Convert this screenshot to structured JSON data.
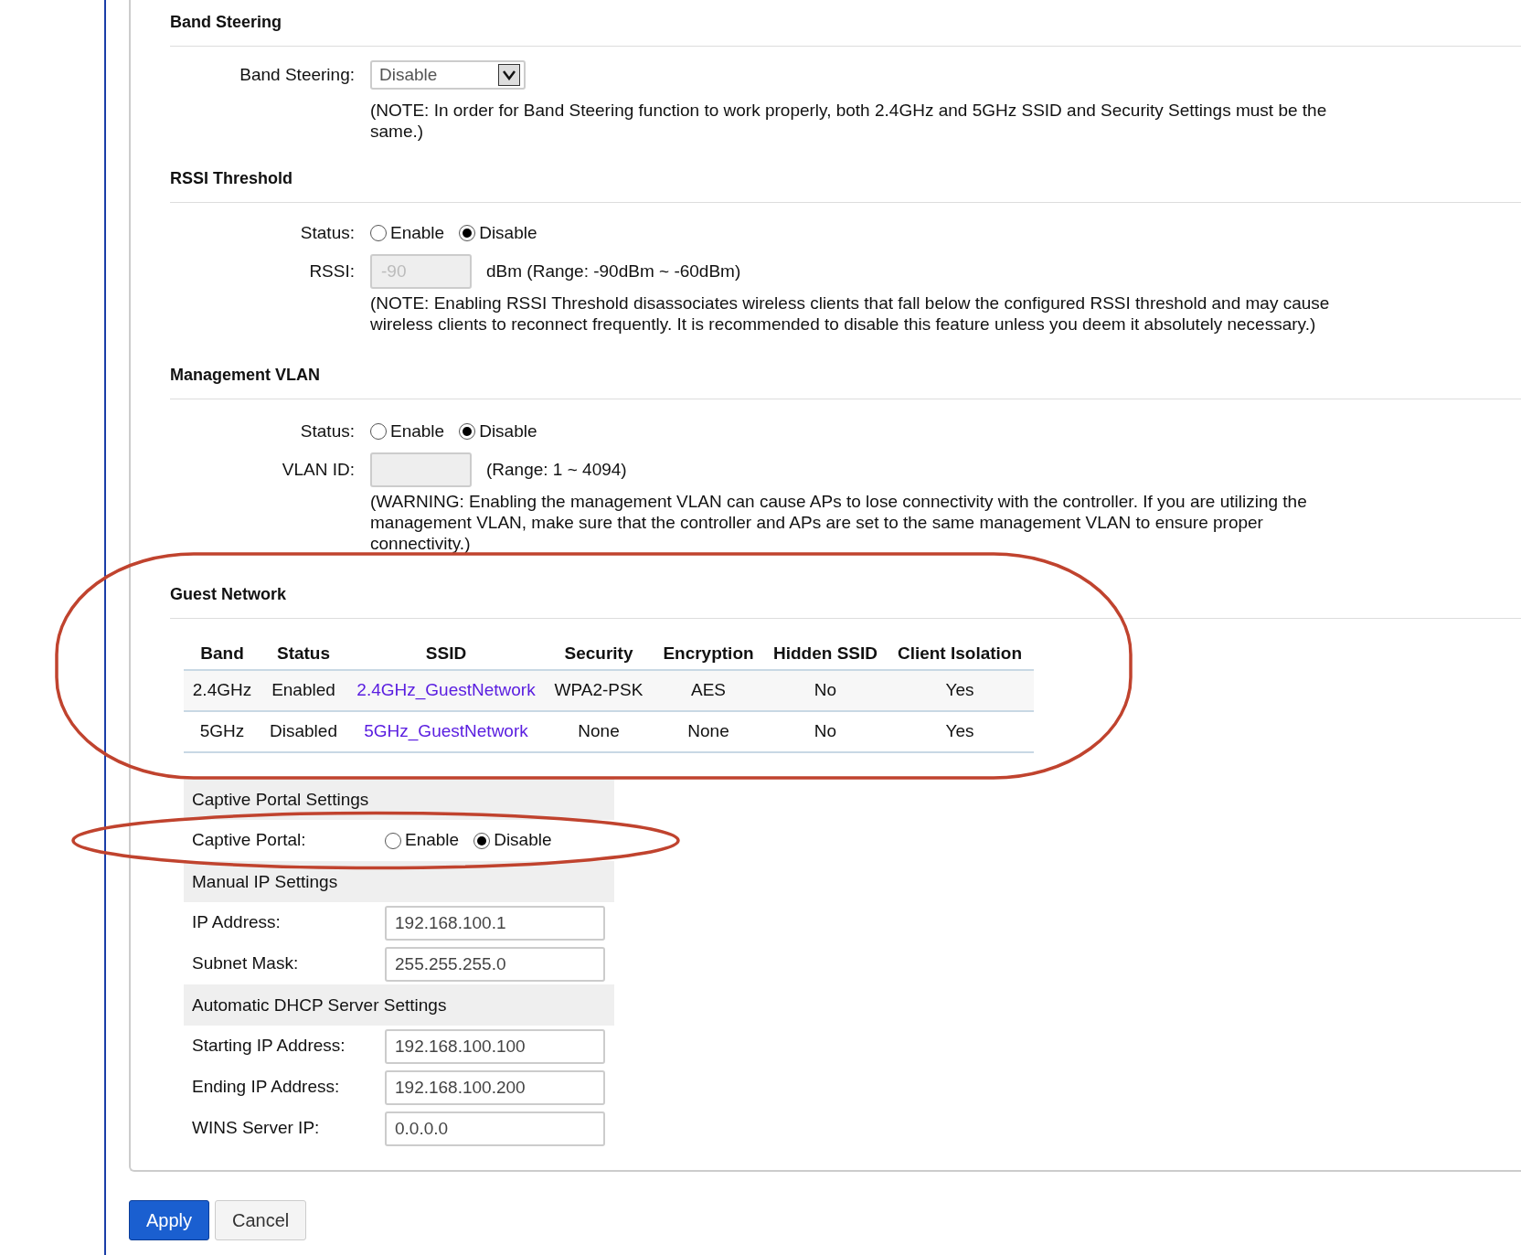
{
  "band_steering": {
    "heading": "Band Steering",
    "label": "Band Steering:",
    "value": "Disable",
    "note": "(NOTE: In order for Band Steering function to work properly, both 2.4GHz and 5GHz SSID and Security Settings must be the same.)"
  },
  "rssi_threshold": {
    "heading": "RSSI Threshold",
    "status_label": "Status:",
    "options": [
      {
        "label": "Enable",
        "selected": false
      },
      {
        "label": "Disable",
        "selected": true
      }
    ],
    "rssi_label": "RSSI:",
    "rssi_value": "-90",
    "rssi_disabled": true,
    "range": "dBm (Range: -90dBm ~ -60dBm)",
    "note": "(NOTE: Enabling RSSI Threshold disassociates wireless clients that fall below the configured RSSI threshold and may cause wireless clients to reconnect frequently. It is recommended to disable this feature unless you deem it absolutely necessary.)"
  },
  "management_vlan": {
    "heading": "Management VLAN",
    "status_label": "Status:",
    "options": [
      {
        "label": "Enable",
        "selected": false
      },
      {
        "label": "Disable",
        "selected": true
      }
    ],
    "vlan_label": "VLAN ID:",
    "vlan_disabled": true,
    "range": "(Range: 1 ~ 4094)",
    "warning": "(WARNING: Enabling the management VLAN can cause APs to lose connectivity with the controller. If you are utilizing the management VLAN, make sure that the controller and APs are set to the same management VLAN to ensure proper connectivity.)"
  },
  "guest_network": {
    "heading": "Guest Network",
    "table": {
      "columns": [
        "Band",
        "Status",
        "SSID",
        "Security",
        "Encryption",
        "Hidden SSID",
        "Client Isolation"
      ],
      "rows": [
        {
          "band": "2.4GHz",
          "status": "Enabled",
          "ssid": "2.4GHz_GuestNetwork",
          "security": "WPA2-PSK",
          "encryption": "AES",
          "hidden_ssid": "No",
          "client_isolation": "Yes"
        },
        {
          "band": "5GHz",
          "status": "Disabled",
          "ssid": "5GHz_GuestNetwork",
          "security": "None",
          "encryption": "None",
          "hidden_ssid": "No",
          "client_isolation": "Yes"
        }
      ]
    }
  },
  "settings": [
    {
      "kind": "header",
      "label": "Captive Portal Settings"
    },
    {
      "kind": "radio",
      "label": "Captive Portal:",
      "options": [
        {
          "label": "Enable",
          "selected": false
        },
        {
          "label": "Disable",
          "selected": true
        }
      ]
    },
    {
      "kind": "header",
      "label": "Manual IP Settings"
    },
    {
      "kind": "input",
      "label": "IP Address:",
      "value": "192.168.100.1"
    },
    {
      "kind": "input",
      "label": "Subnet Mask:",
      "value": "255.255.255.0"
    },
    {
      "kind": "header",
      "label": "Automatic DHCP Server Settings"
    },
    {
      "kind": "input",
      "label": "Starting IP Address:",
      "value": "192.168.100.100"
    },
    {
      "kind": "input",
      "label": "Ending IP Address:",
      "value": "192.168.100.200"
    },
    {
      "kind": "input",
      "label": "WINS Server IP:",
      "value": "0.0.0.0"
    }
  ],
  "buttons": [
    {
      "label": "Apply",
      "kind": "primary"
    },
    {
      "label": "Cancel",
      "kind": "secondary"
    }
  ]
}
